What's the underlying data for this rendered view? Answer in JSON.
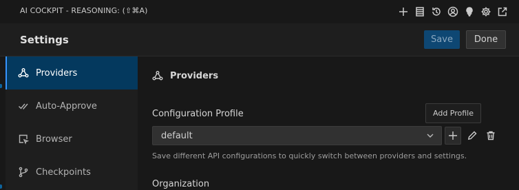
{
  "titlebar": {
    "title": "AI COCKPIT - REASONING: (⇧⌘A)",
    "icons": [
      "plus-icon",
      "server-icon",
      "history-icon",
      "account-icon",
      "lightbulb-icon",
      "gear-icon",
      "popout-icon"
    ]
  },
  "header": {
    "title": "Settings",
    "save_label": "Save",
    "done_label": "Done"
  },
  "sidebar": {
    "items": [
      {
        "label": "Providers",
        "icon": "providers-icon",
        "active": true
      },
      {
        "label": "Auto-Approve",
        "icon": "check-all-icon",
        "active": false
      },
      {
        "label": "Browser",
        "icon": "browser-icon",
        "active": false
      },
      {
        "label": "Checkpoints",
        "icon": "git-branch-icon",
        "active": false
      }
    ]
  },
  "main": {
    "section_title": "Providers",
    "config_label": "Configuration Profile",
    "add_profile_label": "Add Profile",
    "select_value": "default",
    "help_text": "Save different API configurations to quickly switch between providers and settings.",
    "org_label": "Organization"
  },
  "colors": {
    "accent": "#3794ff",
    "active_bg": "#04395e",
    "save_bg": "#0e4773"
  }
}
